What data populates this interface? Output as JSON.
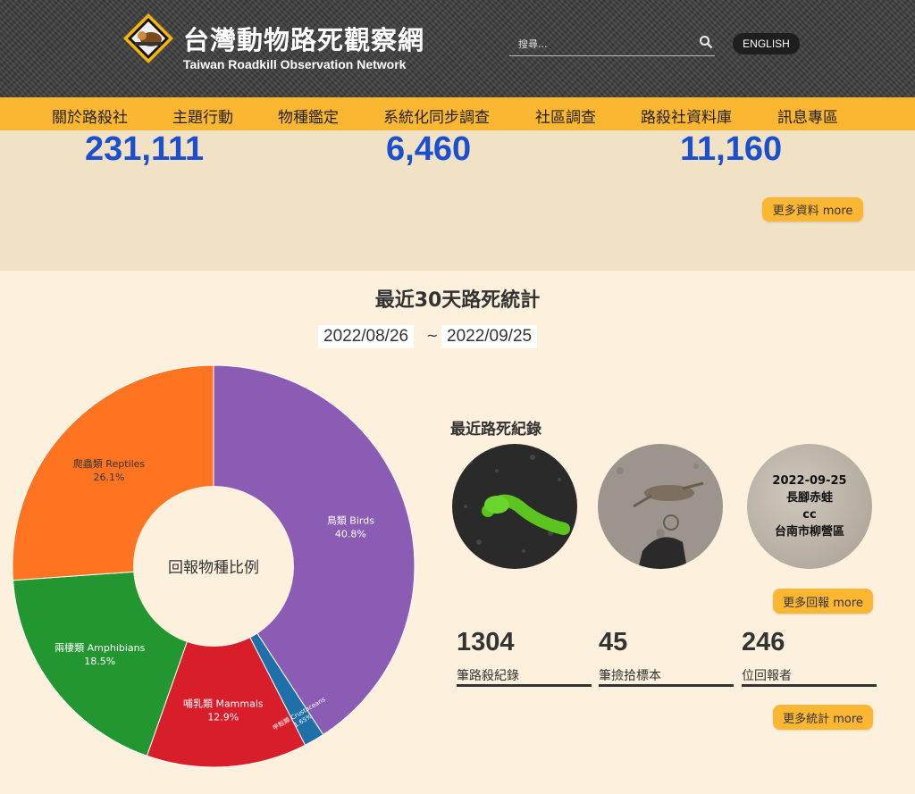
{
  "header": {
    "title": "台灣動物路死觀察網",
    "subtitle": "Taiwan Roadkill Observation Network",
    "search_placeholder": "搜尋...",
    "lang_button": "ENGLISH"
  },
  "nav": {
    "items": [
      "關於路殺社",
      "主題行動",
      "物種鑑定",
      "系統化同步調查",
      "社區調查",
      "路殺社資料庫",
      "訊息專區"
    ]
  },
  "stats": {
    "numbers": [
      "231,111",
      "6,460",
      "11,160"
    ],
    "more_data_button": "更多資料 more"
  },
  "recent30": {
    "title": "最近30天路死統計",
    "date_from": "2022/08/26",
    "date_sep": "~",
    "date_to": "2022/09/25",
    "donut_center": "回報物種比例"
  },
  "chart_data": {
    "type": "pie",
    "donut": true,
    "slices": [
      {
        "label": "鳥類 Birds",
        "percent": 40.8,
        "color": "#8a5cb3"
      },
      {
        "label": "甲殼類 Crustaceans",
        "percent": 1.65,
        "color": "#1f6fa8"
      },
      {
        "label": "哺乳類 Mammals",
        "percent": 12.9,
        "color": "#d81e2b"
      },
      {
        "label": "兩棲類 Amphibians",
        "percent": 18.5,
        "color": "#22962f"
      },
      {
        "label": "爬蟲類 Reptiles",
        "percent": 26.1,
        "color": "#ff7420"
      }
    ],
    "slice_percent_labels": [
      "40.8%",
      "1.65%",
      "12.9%",
      "18.5%",
      "26.1%"
    ]
  },
  "recent_records": {
    "title": "最近路死紀錄",
    "card3": {
      "date": "2022-09-25",
      "species": "長腳赤蛙",
      "license": "cc",
      "location": "台南市柳營區"
    },
    "more_report_button": "更多回報 more"
  },
  "counts": [
    {
      "value": "1304",
      "label": "筆路殺紀錄"
    },
    {
      "value": "45",
      "label": "筆撿拾標本"
    },
    {
      "value": "246",
      "label": "位回報者"
    }
  ],
  "more_stats_button": "更多統計 more",
  "colors": {
    "nav_bg": "#fbb632",
    "number_blue": "#1a4fd0",
    "page_bg": "#fdf0dc",
    "band_bg": "#f1e1c5"
  }
}
